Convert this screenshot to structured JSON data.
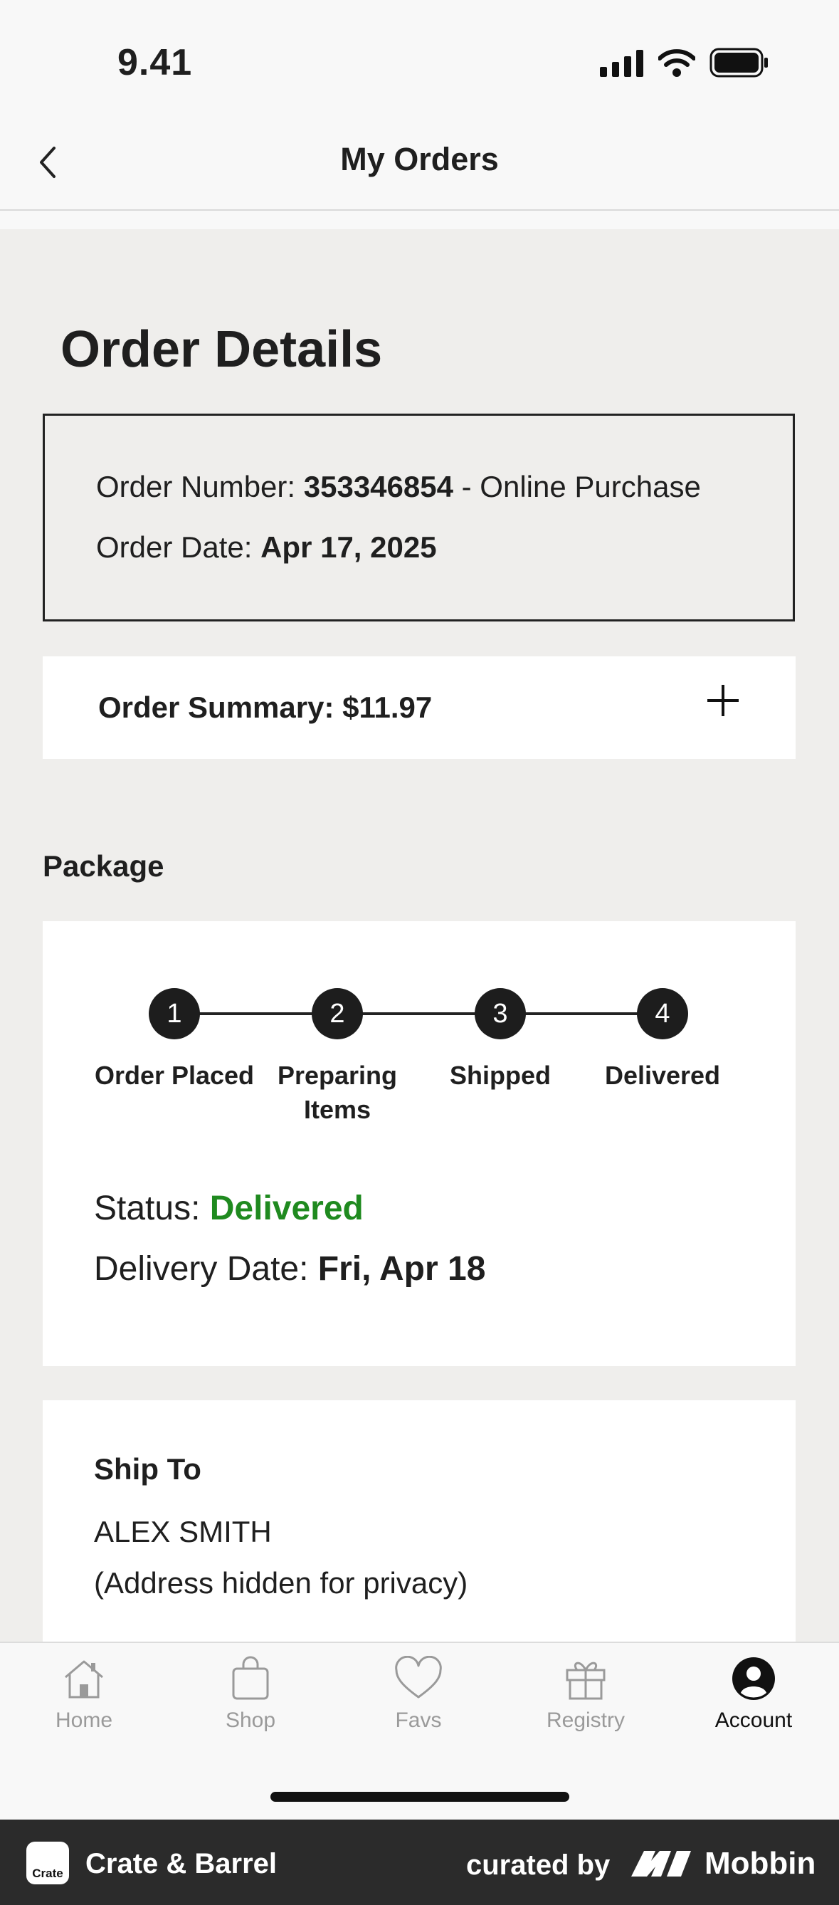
{
  "status_bar": {
    "time": "9.41"
  },
  "header": {
    "title": "My Orders"
  },
  "order_details": {
    "title": "Order Details",
    "order_number_label": "Order Number: ",
    "order_number": "353346854",
    "order_type": " - Online Purchase",
    "order_date_label": "Order Date: ",
    "order_date": "Apr 17, 2025"
  },
  "summary": {
    "label": "Order Summary: $11.97"
  },
  "package": {
    "title": "Package",
    "steps": [
      {
        "number": "1",
        "label": "Order Placed"
      },
      {
        "number": "2",
        "label": "Preparing Items"
      },
      {
        "number": "3",
        "label": "Shipped"
      },
      {
        "number": "4",
        "label": "Delivered"
      }
    ],
    "status_label": "Status: ",
    "status_value": "Delivered",
    "status_color": "#1f8a1f",
    "delivery_label": "Delivery Date: ",
    "delivery_value": "Fri, Apr 18"
  },
  "ship_to": {
    "title": "Ship To",
    "name": "ALEX SMITH",
    "address": "(Address hidden for privacy)"
  },
  "tabs": [
    {
      "label": "Home",
      "icon": "home-icon"
    },
    {
      "label": "Shop",
      "icon": "bag-icon"
    },
    {
      "label": "Favs",
      "icon": "heart-icon"
    },
    {
      "label": "Registry",
      "icon": "gift-icon"
    },
    {
      "label": "Account",
      "icon": "account-icon",
      "active": true
    }
  ],
  "brand_bar": {
    "logo_text": "Crate",
    "brand_name": "Crate & Barrel",
    "curated_by": "curated by",
    "mobbin": "Mobbin"
  }
}
